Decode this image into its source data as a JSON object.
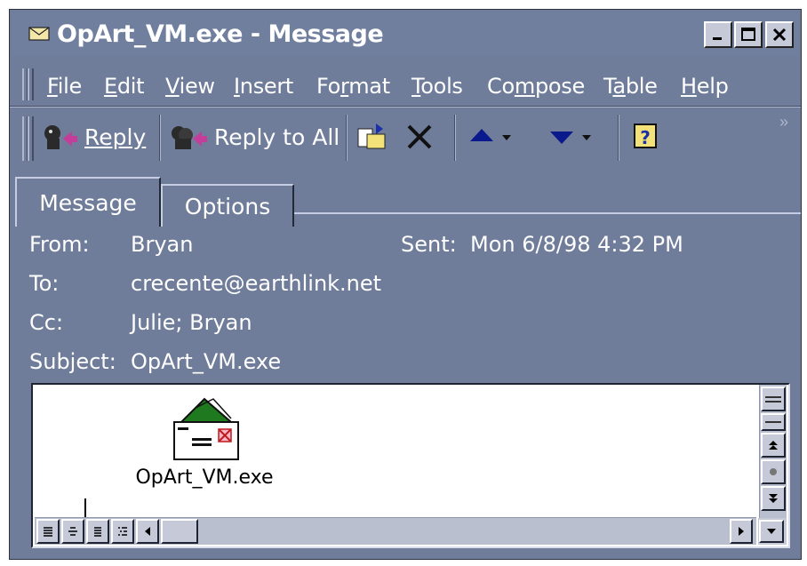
{
  "window": {
    "title": "OpArt_VM.exe - Message",
    "controls": {
      "minimize": "_",
      "maximize": "□",
      "close": "X"
    }
  },
  "menu": [
    {
      "label": "File",
      "key": "F",
      "rest": "ile",
      "pre": ""
    },
    {
      "label": "Edit",
      "key": "E",
      "rest": "dit",
      "pre": ""
    },
    {
      "label": "View",
      "key": "V",
      "rest": "iew",
      "pre": ""
    },
    {
      "label": "Insert",
      "key": "I",
      "rest": "nsert",
      "pre": ""
    },
    {
      "label": "Format",
      "key": "r",
      "rest": "mat",
      "pre": "Fo"
    },
    {
      "label": "Tools",
      "key": "T",
      "rest": "ools",
      "pre": ""
    },
    {
      "label": "Compose",
      "key": "m",
      "rest": "pose",
      "pre": "Co"
    },
    {
      "label": "Table",
      "key": "a",
      "rest": "ble",
      "pre": "T"
    },
    {
      "label": "Help",
      "key": "H",
      "rest": "elp",
      "pre": ""
    }
  ],
  "toolbar": {
    "reply_label": "Reply",
    "reply_all_label": "Reply to All",
    "overflow": "»"
  },
  "tabs": {
    "message": "Message",
    "options": "Options"
  },
  "header": {
    "from_label": "From:",
    "from_value": "Bryan",
    "sent_label": "Sent:",
    "sent_value": "Mon 6/8/98 4:32 PM",
    "to_label": "To:",
    "to_value": "crecente@earthlink.net",
    "cc_label": "Cc:",
    "cc_value": "Julie; Bryan",
    "subject_label": "Subject:",
    "subject_value": "OpArt_VM.exe"
  },
  "attachment": {
    "name": "OpArt_VM.exe",
    "icon": "email-attachment-icon"
  },
  "colors": {
    "window_bg": "#6f7c9a",
    "highlight": "#c7cde0",
    "shadow": "#232838"
  }
}
